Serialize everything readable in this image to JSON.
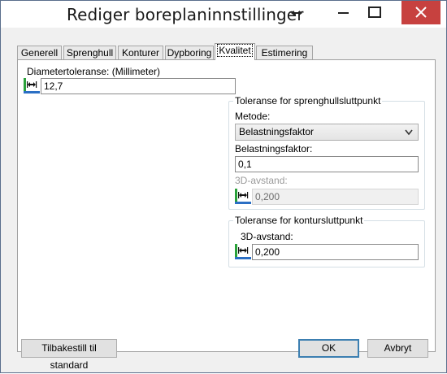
{
  "window": {
    "title": "Rediger boreplaninnstillinger",
    "close_color": "#c7413f"
  },
  "tabs": [
    {
      "label": "Generell"
    },
    {
      "label": "Sprenghull"
    },
    {
      "label": "Konturer"
    },
    {
      "label": "Dypboring"
    },
    {
      "label": "Kvalitet",
      "active": true
    },
    {
      "label": "Estimering"
    }
  ],
  "diameter": {
    "label": "Diametertoleranse: (Millimeter)",
    "value": "12,7"
  },
  "blast_group": {
    "title": "Toleranse for sprenghullsluttpunkt",
    "method_label": "Metode:",
    "method_value": "Belastningsfaktor",
    "factor_label": "Belastningsfaktor:",
    "factor_value": "0,1",
    "distance_label": "3D-avstand:",
    "distance_value": "0,200"
  },
  "contour_group": {
    "title": "Toleranse for kontursluttpunkt",
    "distance_label": "3D-avstand:",
    "distance_value": "0,200"
  },
  "buttons": {
    "reset": "Tilbakestill til standard",
    "ok": "OK",
    "cancel": "Avbryt"
  }
}
